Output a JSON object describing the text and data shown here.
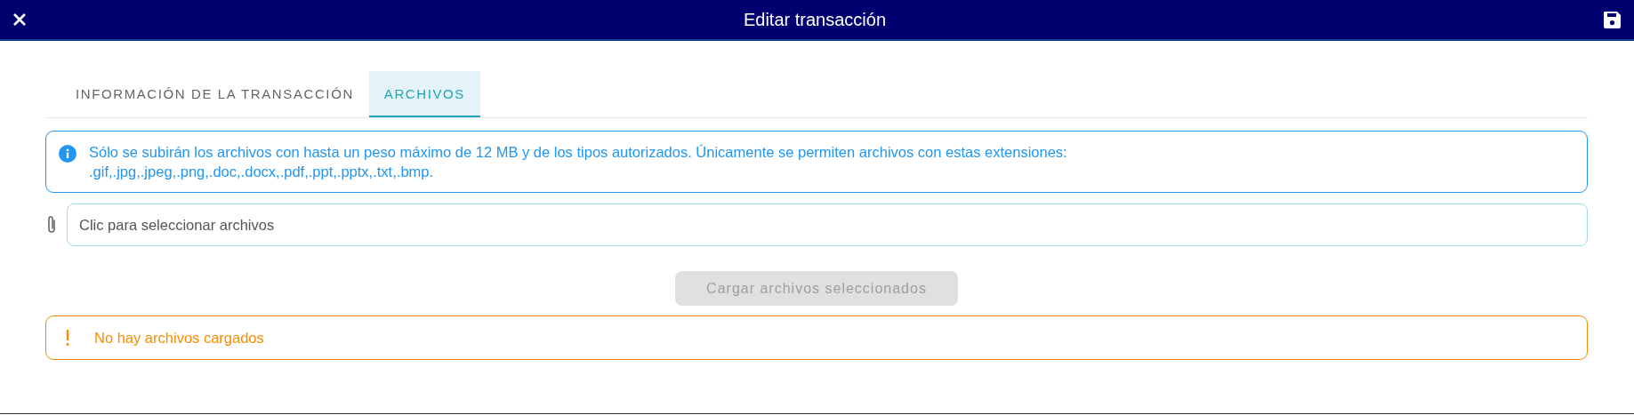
{
  "window": {
    "title": "Editar transacción"
  },
  "tabs": [
    {
      "label": "INFORMACIÓN DE LA TRANSACCIÓN",
      "selected": false
    },
    {
      "label": "ARCHIVOS",
      "selected": true
    }
  ],
  "info_alert": {
    "text": "Sólo se subirán los archivos con hasta un peso máximo de 12 MB y de los tipos autorizados. Únicamente se permiten archivos con estas extensiones:",
    "extensions": ".gif,.jpg,.jpeg,.png,.doc,.docx,.pdf,.ppt,.pptx,.txt,.bmp."
  },
  "file_field": {
    "placeholder": "Clic para seleccionar archivos"
  },
  "upload_button": {
    "label": "Cargar archivos seleccionados",
    "disabled": true
  },
  "warning_alert": {
    "text": "No hay archivos cargados"
  }
}
